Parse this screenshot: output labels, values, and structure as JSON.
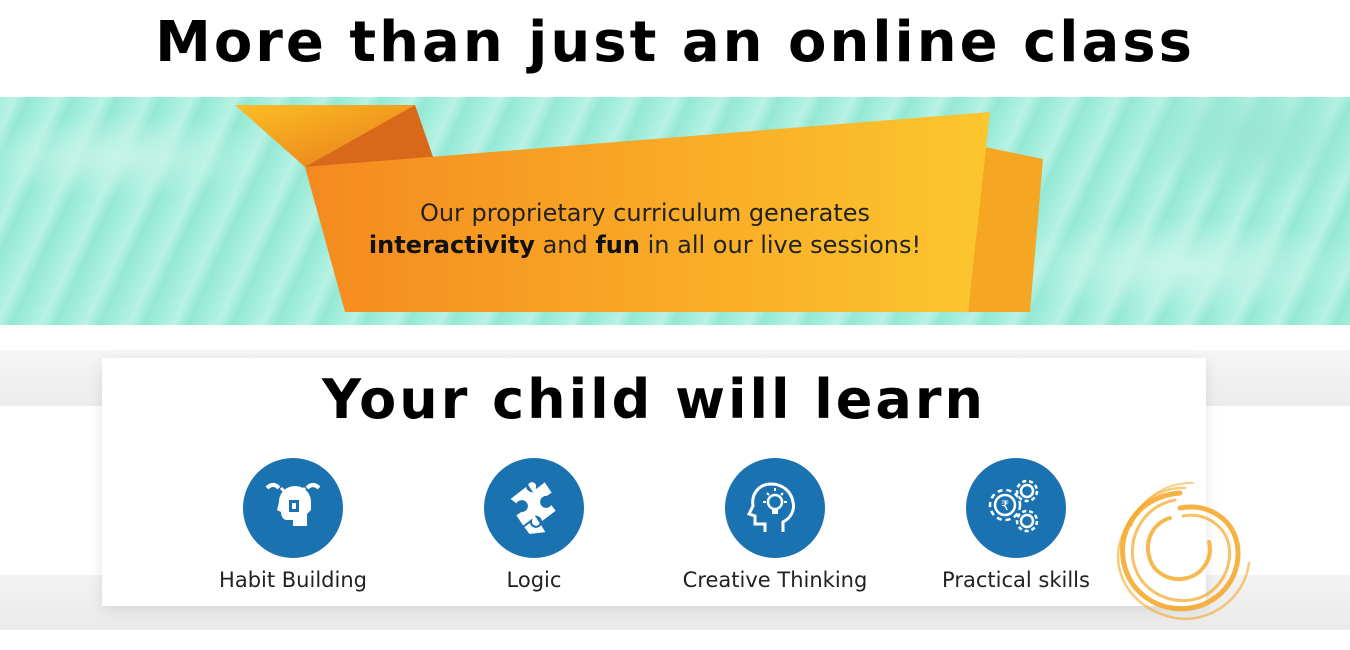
{
  "header": {
    "title": "More than just an online class"
  },
  "banner": {
    "line1": "Our proprietary curriculum generates",
    "bold1": "interactivity",
    "mid": "and",
    "bold2": "fun",
    "tail": "in all our live sessions!"
  },
  "learn": {
    "title": "Your child will learn",
    "skills": [
      {
        "label": "Habit Building",
        "icon": "brain-habit-icon"
      },
      {
        "label": "Logic",
        "icon": "puzzle-icon"
      },
      {
        "label": "Creative Thinking",
        "icon": "head-lightbulb-icon"
      },
      {
        "label": "Practical skills",
        "icon": "rupee-gears-icon"
      }
    ]
  },
  "colors": {
    "ribbon_orange": "#f7941d",
    "ribbon_yellow": "#fbbf24",
    "icon_circle": "#1b72b0",
    "band_mint": "#a3eedc",
    "swirl_orange": "#f5a623"
  }
}
